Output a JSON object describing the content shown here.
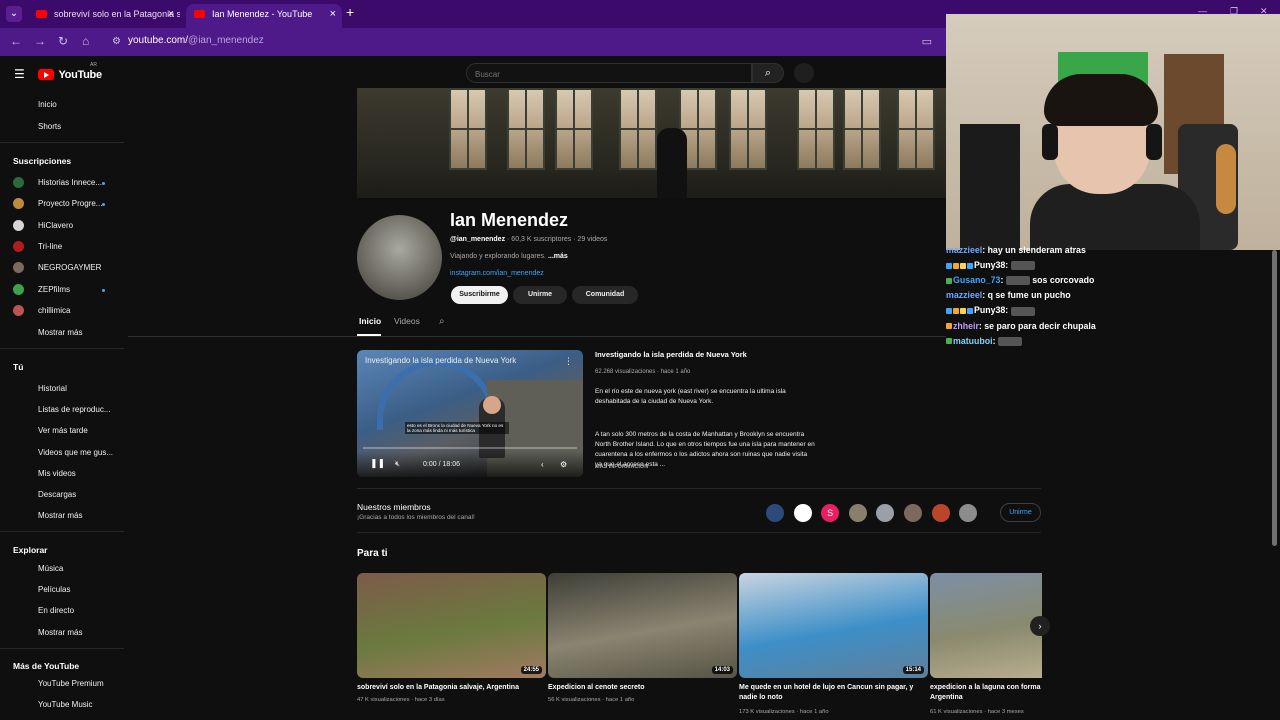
{
  "browser": {
    "tabs": [
      {
        "label": "sobreviví solo en la Patagonia s",
        "active": false
      },
      {
        "label": "Ian Menendez - YouTube",
        "active": true
      }
    ],
    "url_host": "youtube.com/",
    "url_path": "@ian_menendez"
  },
  "header": {
    "logo_text": "YouTube",
    "logo_country": "AR",
    "search_placeholder": "Buscar"
  },
  "sidebar": {
    "top": [
      "Inicio",
      "Shorts"
    ],
    "subs_title": "Suscripciones",
    "subs": [
      {
        "name": "Historias Innece...",
        "color": "#2b6a3a",
        "dot": true
      },
      {
        "name": "Proyecto Progre...",
        "color": "#c08a3e",
        "dot": true
      },
      {
        "name": "HiClavero",
        "color": "#d5d5d5",
        "dot": false
      },
      {
        "name": "Tri-line",
        "color": "#b11d1d",
        "dot": false
      },
      {
        "name": "NEGROGAYMER",
        "color": "#7d6a5a",
        "dot": false
      },
      {
        "name": "ZEPfilms",
        "color": "#3ca24a",
        "dot": true
      },
      {
        "name": "chillimica",
        "color": "#b55",
        "dot": false
      }
    ],
    "subs_more": "Mostrar más",
    "you_title": "Tú",
    "you": [
      "Historial",
      "Listas de reproduc...",
      "Ver más tarde",
      "Videos que me gus...",
      "Mis videos",
      "Descargas",
      "Mostrar más"
    ],
    "explore_title": "Explorar",
    "explore": [
      "Música",
      "Películas",
      "En directo",
      "Mostrar más"
    ],
    "more_title": "Más de YouTube",
    "more": [
      "YouTube Premium",
      "YouTube Music"
    ]
  },
  "channel": {
    "name": "Ian Menendez",
    "handle": "@ian_menendez",
    "stats": " · 60,3 K suscriptores · 29 videos",
    "description": "Viajando y explorando lugares. ",
    "more": "...más",
    "link": "instagram.com/ian_menendez",
    "subscribe": "Suscribirme",
    "join": "Unirme",
    "community": "Comunidad"
  },
  "channel_tabs": [
    "Inicio",
    "Videos"
  ],
  "featured": {
    "player_title": "Investigando la isla perdida de Nueva York",
    "caption": "esto es el Bronx la ciudad de Nueva York no es la zona más linda ni más turística",
    "time": "0:00 / 18:06",
    "progress": 0.0,
    "title": "Investigando la isla perdida de Nueva York",
    "meta": "62.268 visualizaciones · hace 1 año",
    "para1": "En el río este de nueva york (east river) se encuentra la ultima isla deshabitada de la ciudad de Nueva York.",
    "para2": "A tan solo 300 metros de la costa de Manhattan y Brooklyn se encuentra North Brother Island. Lo que en otros tiempos fue una isla para mantener en cuarentena a los enfermos o los adictos ahora son ruinas que nadie visita ya que el acceso esta ...",
    "more": "MÁS INFORMACIÓN"
  },
  "members": {
    "title": "Nuestros miembros",
    "subtitle": "¡Gracias a todos los miembros del canal!",
    "avatars": [
      {
        "letter": "",
        "color": "#2d4a7a"
      },
      {
        "letter": "",
        "color": "#ffffff"
      },
      {
        "letter": "S",
        "color": "#e91e63"
      },
      {
        "letter": "",
        "color": "#8a7f6a"
      },
      {
        "letter": "",
        "color": "#9aa0a6"
      },
      {
        "letter": "",
        "color": "#7a6a5a"
      },
      {
        "letter": "",
        "color": "#b9462b"
      },
      {
        "letter": "",
        "color": "#8c8c8c"
      }
    ],
    "join": "Unirme"
  },
  "para_ti": {
    "title": "Para ti",
    "videos": [
      {
        "title": "sobreviví solo en la Patagonia salvaje, Argentina",
        "meta": "47 K visualizaciones · hace 3 días",
        "duration": "24:55",
        "colors": [
          "#7d5b4a",
          "#6b7a3f",
          "#a07a62"
        ]
      },
      {
        "title": "Expedicion al cenote secreto",
        "meta": "56 K visualizaciones · hace 1 año",
        "duration": "14:03",
        "colors": [
          "#3e3f37",
          "#8a8471",
          "#565445"
        ]
      },
      {
        "title": "Me quede en un hotel de lujo en Cancun sin pagar, y nadie lo noto",
        "meta": "173 K visualizaciones · hace 1 año",
        "duration": "15:14",
        "colors": [
          "#c9d4df",
          "#3d8fc8",
          "#5f7f9a"
        ]
      },
      {
        "title": "expedicion a la laguna con forma Argentina",
        "meta": "61 K visualizaciones · hace 3 meses",
        "duration": "",
        "colors": [
          "#7c8fa6",
          "#8a8a6e",
          "#b8ad8f"
        ]
      }
    ]
  },
  "chat": [
    {
      "user": "mazzieel",
      "text": "hay un slenderam atras",
      "color": "#6ea8ff",
      "badges": []
    },
    {
      "user": "Puny38",
      "text": "",
      "color": "#ffffff",
      "badges": [
        "#3ea6ff",
        "#f5a623",
        "#ffd54f",
        "#3ea6ff"
      ],
      "emote": true
    },
    {
      "user": "Gusano_73",
      "text": "sos corcovado",
      "color": "#3ea6ff",
      "badges": [
        "#4caf50"
      ],
      "emote": true
    },
    {
      "user": "mazzieel",
      "text": "q se fume un pucho",
      "color": "#6ea8ff",
      "badges": []
    },
    {
      "user": "Puny38",
      "text": "",
      "color": "#ffffff",
      "badges": [
        "#3ea6ff",
        "#f5a623",
        "#ffd54f",
        "#3ea6ff"
      ],
      "emote": true
    },
    {
      "user": "zhheir",
      "text": "se paro para decir chupala",
      "color": "#c39bff",
      "badges": [
        "#f5a623"
      ]
    },
    {
      "user": "matuuboi",
      "text": "",
      "color": "#7fd4ff",
      "badges": [
        "#4caf50"
      ],
      "emote": true
    }
  ]
}
